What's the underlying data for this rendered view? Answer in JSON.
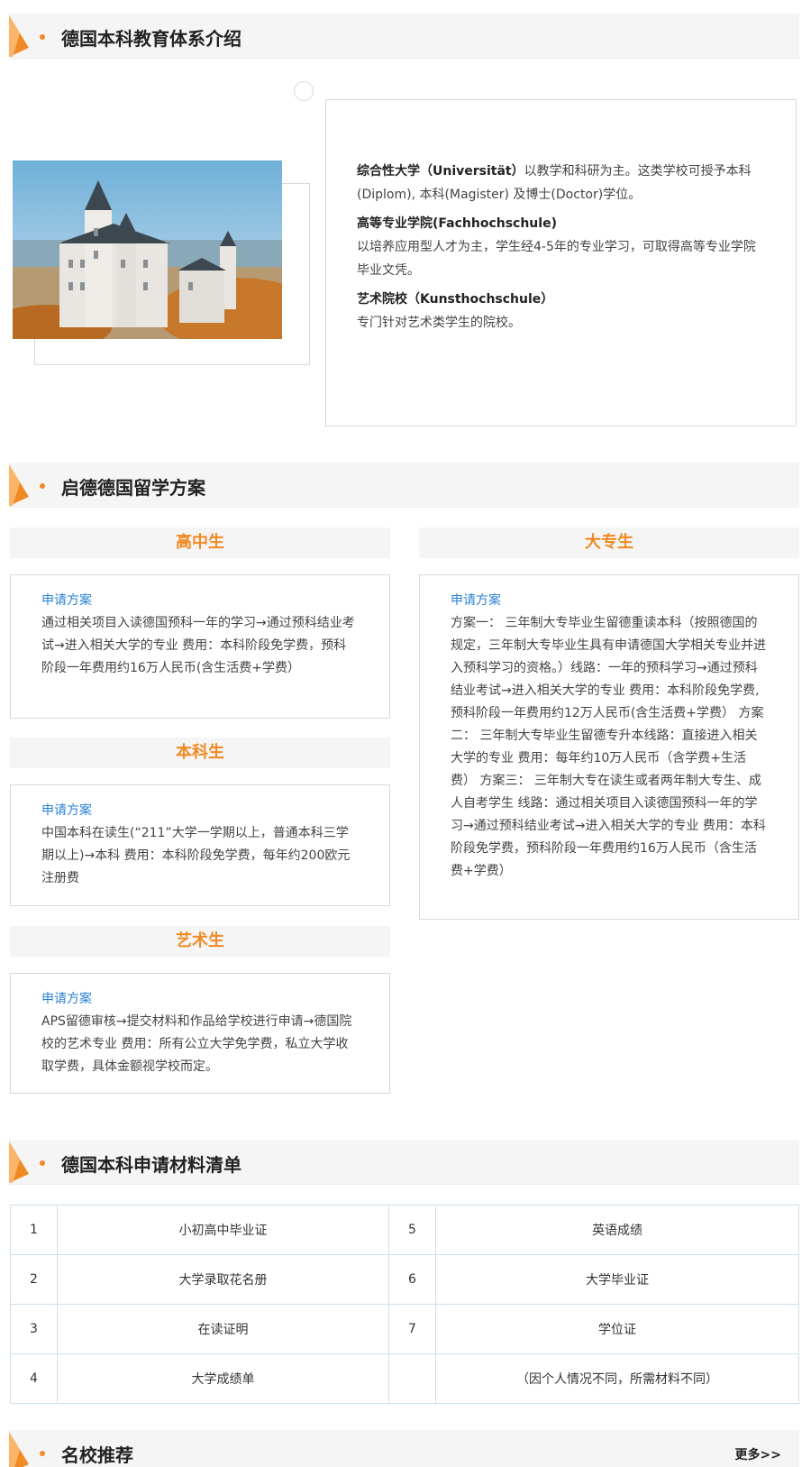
{
  "sections": {
    "intro": {
      "title": "德国本科教育体系介绍"
    },
    "plans": {
      "title": "启德德国留学方案"
    },
    "materials": {
      "title": "德国本科申请材料清单"
    },
    "schools": {
      "title": "名校推荐",
      "more": "更多>>"
    }
  },
  "intro": {
    "items": [
      {
        "title": "综合性大学（Universität）",
        "text": "以教学和科研为主。这类学校可授予本科(Diplom), 本科(Magister) 及博士(Doctor)学位。"
      },
      {
        "title": "高等专业学院(Fachhochschule)",
        "text": "以培养应用型人才为主，学生经4-5年的专业学习，可取得高等专业学院毕业文凭。"
      },
      {
        "title": "艺术院校（Kunsthochschule）",
        "text": "专门针对艺术类学生的院校。"
      }
    ]
  },
  "plans": {
    "apply_label": "申请方案",
    "high_school": {
      "title": "高中生",
      "text": "通过相关项目入读德国预科一年的学习→通过预科结业考试→进入相关大学的专业 费用：本科阶段免学费，预科阶段一年费用约16万人民币(含生活费+学费）"
    },
    "undergrad": {
      "title": "本科生",
      "text": "中国本科在读生(“211”大学一学期以上，普通本科三学期以上)→本科 费用：本科阶段免学费，每年约200欧元注册费"
    },
    "art": {
      "title": "艺术生",
      "text": "APS留德审核→提交材料和作品给学校进行申请→德国院校的艺术专业 费用：所有公立大学免学费，私立大学收取学费，具体金额视学校而定。"
    },
    "college": {
      "title": "大专生",
      "text": "方案一： 三年制大专毕业生留德重读本科（按照德国的规定，三年制大专毕业生具有申请德国大学相关专业并进入预科学习的资格。）线路：一年的预科学习→通过预科结业考试→进入相关大学的专业 费用：本科阶段免学费,预科阶段一年费用约12万人民币(含生活费+学费） 方案二： 三年制大专毕业生留德专升本线路：直接进入相关大学的专业 费用：每年约10万人民币（含学费+生活费） 方案三： 三年制大专在读生或者两年制大专生、成人自考学生 线路：通过相关项目入读德国预科一年的学习→通过预科结业考试→进入相关大学的专业 费用：本科阶段免学费，预科阶段一年费用约16万人民币（含生活费+学费）"
    }
  },
  "materials": {
    "rows": [
      {
        "n1": "1",
        "m1": "小初高中毕业证",
        "n2": "5",
        "m2": "英语成绩"
      },
      {
        "n1": "2",
        "m1": "大学录取花名册",
        "n2": "6",
        "m2": "大学毕业证"
      },
      {
        "n1": "3",
        "m1": "在读证明",
        "n2": "7",
        "m2": "学位证"
      },
      {
        "n1": "4",
        "m1": "大学成绩单",
        "n2": "",
        "m2": "（因个人情况不同，所需材料不同）"
      }
    ]
  },
  "colors": {
    "accent": "#f08a24",
    "link": "#2a7fd4",
    "header_bg": "#f5f5f5",
    "border": "#d9d9d9"
  },
  "icons": {
    "section_flag": "orange-pennant-icon",
    "photo": "castle-photo"
  }
}
